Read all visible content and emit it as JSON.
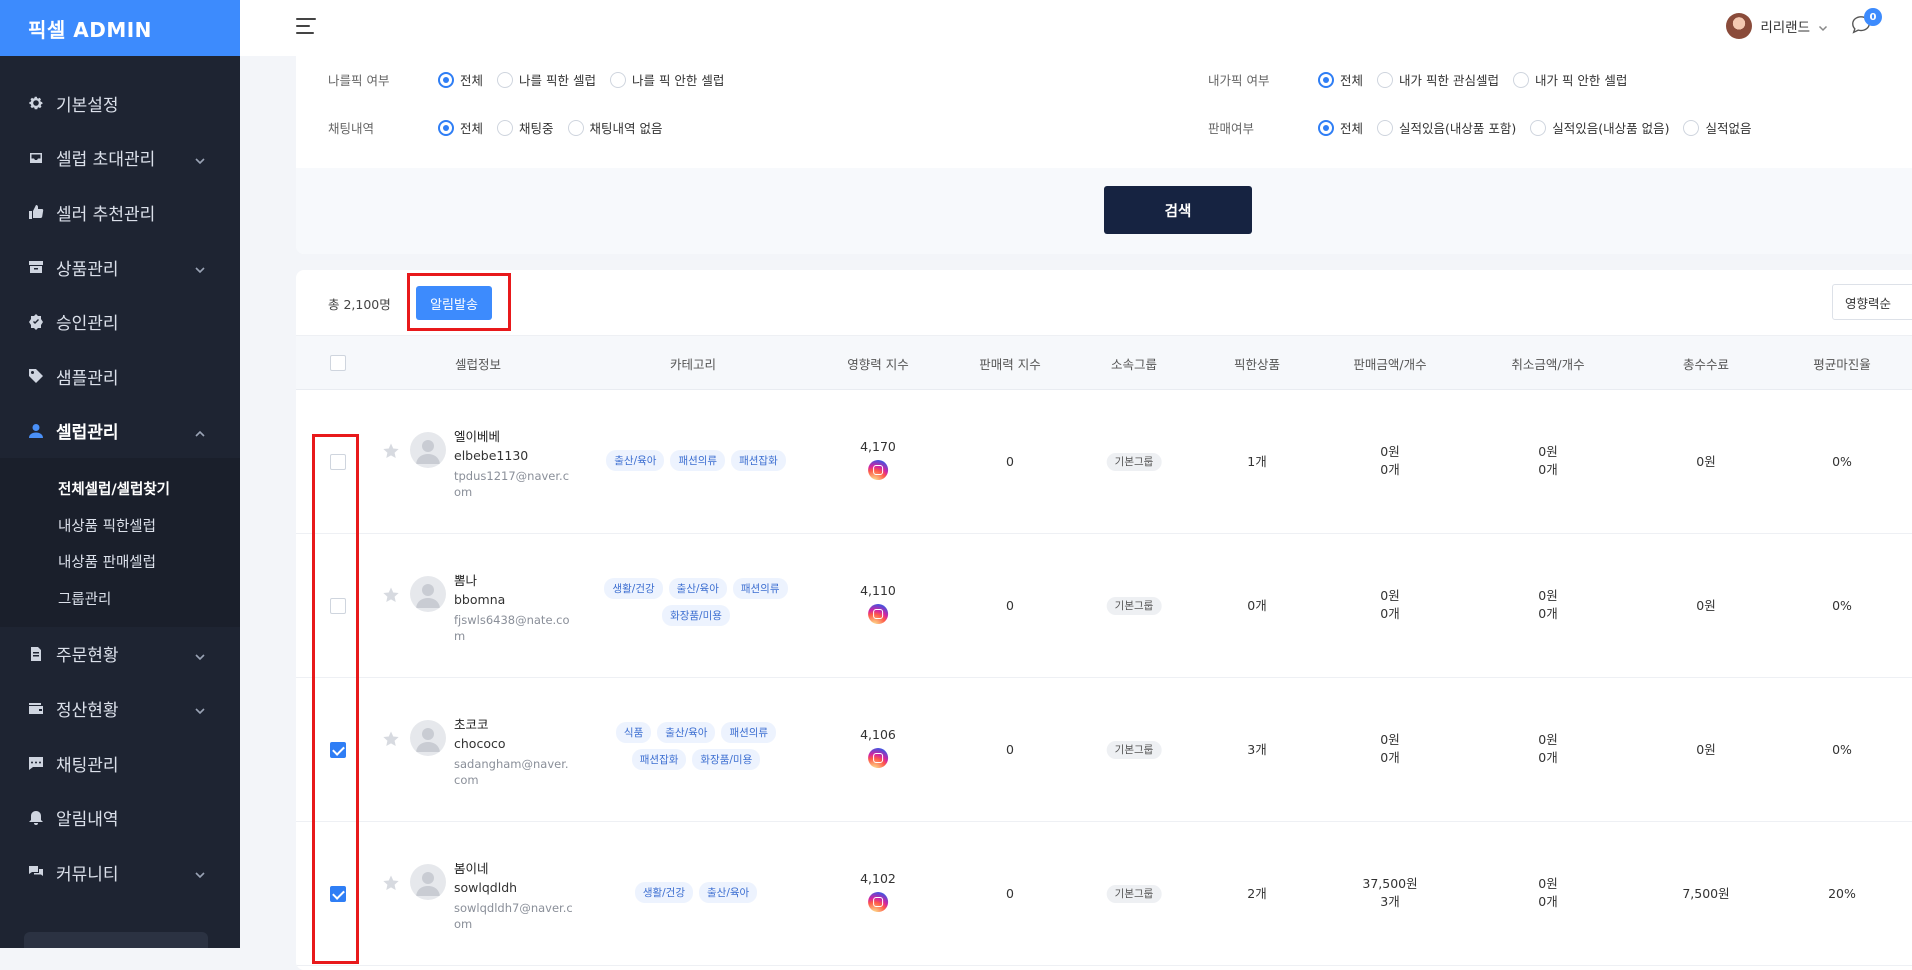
{
  "app": {
    "brand": "픽셀 ADMIN"
  },
  "sidebar": {
    "items": [
      {
        "label": "기본설정",
        "icon": "gear-icon",
        "has_chevron": false
      },
      {
        "label": "셀럽 초대관리",
        "icon": "inbox-icon",
        "has_chevron": true
      },
      {
        "label": "셀러 추천관리",
        "icon": "thumbs-up-icon",
        "has_chevron": false
      },
      {
        "label": "상품관리",
        "icon": "archive-icon",
        "has_chevron": true
      },
      {
        "label": "승인관리",
        "icon": "check-badge-icon",
        "has_chevron": false
      },
      {
        "label": "샘플관리",
        "icon": "tag-icon",
        "has_chevron": false
      },
      {
        "label": "셀럽관리",
        "icon": "user-icon",
        "has_chevron": true,
        "active": true
      }
    ],
    "subitems": [
      {
        "label": "전체셀럽/셀럽찾기",
        "active": true
      },
      {
        "label": "내상품 픽한셀럽"
      },
      {
        "label": "내상품 판매셀럽"
      },
      {
        "label": "그룹관리"
      }
    ],
    "items_after": [
      {
        "label": "주문현황",
        "icon": "file-icon",
        "has_chevron": true
      },
      {
        "label": "정산현황",
        "icon": "wallet-icon",
        "has_chevron": true
      },
      {
        "label": "채팅관리",
        "icon": "chat-icon",
        "has_chevron": false
      },
      {
        "label": "알림내역",
        "icon": "bell-icon",
        "has_chevron": false
      },
      {
        "label": "커뮤니티",
        "icon": "comments-icon",
        "has_chevron": true
      }
    ]
  },
  "topbar": {
    "user_name": "리리랜드",
    "message_count": "0"
  },
  "filters": {
    "row1_left": {
      "label": "나를픽 여부",
      "options": [
        "전체",
        "나를 픽한 셀럽",
        "나를 픽 안한 셀럽"
      ],
      "selected": 0
    },
    "row1_right": {
      "label": "내가픽 여부",
      "options": [
        "전체",
        "내가 픽한 관심셀럽",
        "내가 픽 안한 셀럽"
      ],
      "selected": 0
    },
    "row2_left": {
      "label": "채팅내역",
      "options": [
        "전체",
        "채팅중",
        "채팅내역 없음"
      ],
      "selected": 0
    },
    "row2_right": {
      "label": "판매여부",
      "options": [
        "전체",
        "실적있음(내상품 포함)",
        "실적있음(내상품 없음)",
        "실적없음"
      ],
      "selected": 0
    },
    "search_label": "검색"
  },
  "list": {
    "total": "총 2,100명",
    "notify_label": "알림발송",
    "sort_label": "영향력순",
    "columns": [
      "셀럽정보",
      "카테고리",
      "영향력 지수",
      "판매력 지수",
      "소속그룹",
      "픽한상품",
      "판매금액/개수",
      "취소금액/개수",
      "총수수료",
      "평균마진율"
    ],
    "rows": [
      {
        "checked": false,
        "name": "엘이베베",
        "id": "elbebe1130",
        "email": "tpdus1217@naver.com",
        "tags": [
          "출산/육아",
          "패션의류",
          "패션잡화"
        ],
        "influence": "4,170",
        "sales_index": "0",
        "group": "기본그룹",
        "picked": "1개",
        "sales_amt": "0원",
        "sales_cnt": "0개",
        "cancel_amt": "0원",
        "cancel_cnt": "0개",
        "fee": "0원",
        "margin": "0%"
      },
      {
        "checked": false,
        "name": "뽐나",
        "id": "bbomna",
        "email": "fjswls6438@nate.com",
        "tags": [
          "생활/건강",
          "출산/육아",
          "패션의류",
          "화장품/미용"
        ],
        "influence": "4,110",
        "sales_index": "0",
        "group": "기본그룹",
        "picked": "0개",
        "sales_amt": "0원",
        "sales_cnt": "0개",
        "cancel_amt": "0원",
        "cancel_cnt": "0개",
        "fee": "0원",
        "margin": "0%"
      },
      {
        "checked": true,
        "name": "초코코",
        "id": "chococo",
        "email": "sadangham@naver.com",
        "tags": [
          "식품",
          "출산/육아",
          "패션의류",
          "패션잡화",
          "화장품/미용"
        ],
        "influence": "4,106",
        "sales_index": "0",
        "group": "기본그룹",
        "picked": "3개",
        "sales_amt": "0원",
        "sales_cnt": "0개",
        "cancel_amt": "0원",
        "cancel_cnt": "0개",
        "fee": "0원",
        "margin": "0%"
      },
      {
        "checked": true,
        "name": "봄이네",
        "id": "sowlqdldh",
        "email": "sowlqdldh7@naver.com",
        "tags": [
          "생활/건강",
          "출산/육아"
        ],
        "influence": "4,102",
        "sales_index": "0",
        "group": "기본그룹",
        "picked": "2개",
        "sales_amt": "37,500원",
        "sales_cnt": "3개",
        "cancel_amt": "0원",
        "cancel_cnt": "0개",
        "fee": "7,500원",
        "margin": "20%"
      }
    ]
  },
  "colors": {
    "accent": "#3d8bfd",
    "sidebar_bg": "#1e2432",
    "highlight": "#e8191b",
    "search_btn": "#162341"
  }
}
